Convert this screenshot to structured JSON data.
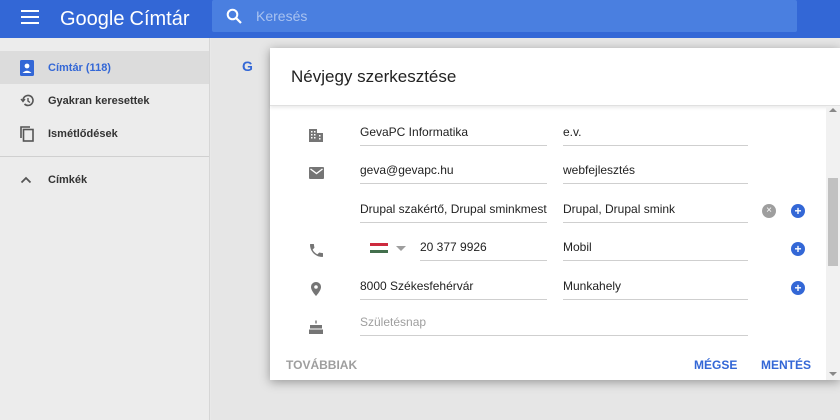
{
  "app": {
    "brand_google": "Google",
    "brand_product": "Címtár"
  },
  "search": {
    "placeholder": "Keresés"
  },
  "sidebar": {
    "items": [
      {
        "label": "Címtár (118)"
      },
      {
        "label": "Gyakran keresettek"
      },
      {
        "label": "Ismétlődések"
      },
      {
        "label": "Címkék"
      }
    ]
  },
  "main": {
    "group_letter": "G"
  },
  "dialog": {
    "title": "Névjegy szerkesztése",
    "company": {
      "name": "GevaPC Informatika",
      "form": "e.v."
    },
    "email": {
      "value": "geva@gevapc.hu",
      "label": "webfejlesztés"
    },
    "tags": {
      "value": "Drupal szakértő, Drupal sminkmester",
      "label": "Drupal, Drupal smink"
    },
    "phone": {
      "value": "20 377 9926",
      "label": "Mobil",
      "country_flag": "hungary-flag"
    },
    "address": {
      "value": "8000 Székesfehérvár",
      "label": "Munkahely"
    },
    "birthday": {
      "placeholder": "Születésnap"
    },
    "buttons": {
      "more": "TOVÁBBIAK",
      "cancel": "MÉGSE",
      "save": "MENTÉS"
    }
  },
  "colors": {
    "accent": "#3367d6",
    "topbar": "#3367d6",
    "flag_red": "#cd2a3e",
    "flag_white": "#ffffff",
    "flag_green": "#436f4d"
  }
}
